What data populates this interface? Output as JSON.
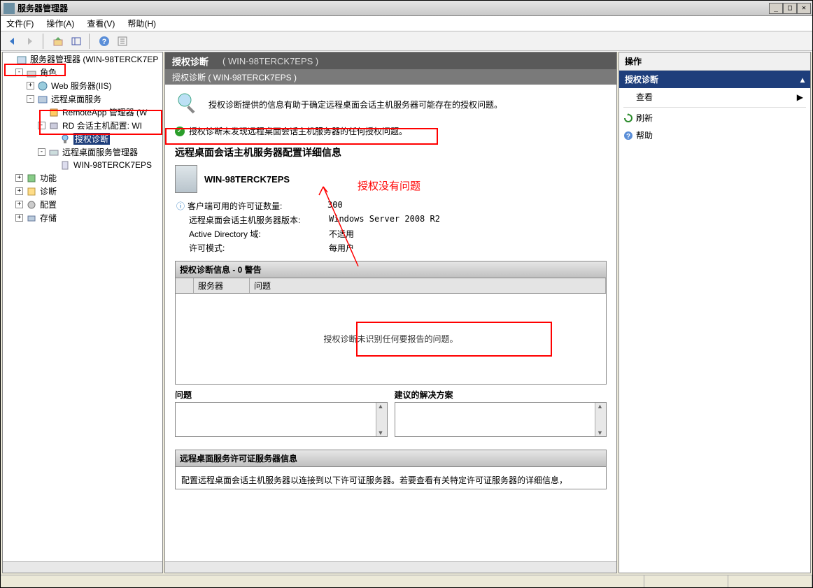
{
  "title": "服务器管理器",
  "menu": {
    "file": "文件(F)",
    "action": "操作(A)",
    "view": "查看(V)",
    "help": "帮助(H)"
  },
  "tree": {
    "root": "服务器管理器 (WIN-98TERCK7EP",
    "roles": "角色",
    "iis": "Web 服务器(IIS)",
    "rds": "远程桌面服务",
    "remoteapp": "RemoteApp 管理器  (W",
    "rdhost": "RD 会话主机配置: WI",
    "licdiag": "授权诊断",
    "rdsmgr": "远程桌面服务管理器",
    "servername": "WIN-98TERCK7EPS",
    "features": "功能",
    "diag": "诊断",
    "config": "配置",
    "storage": "存储"
  },
  "headerTitle": "授权诊断",
  "headerSub": "( WIN-98TERCK7EPS )",
  "header2": "授权诊断 ( WIN-98TERCK7EPS )",
  "intro": "授权诊断提供的信息有助于确定远程桌面会话主机服务器可能存在的授权问题。",
  "statusOk": "授权诊断未发现远程桌面会话主机服务器的任何授权问题。",
  "detailsTitle": "远程桌面会话主机服务器配置详细信息",
  "server": "WIN-98TERCK7EPS",
  "kv": {
    "licCountLabel": "客户端可用的许可证数量:",
    "licCount": "300",
    "verLabel": "远程桌面会话主机服务器版本:",
    "ver": "Windows Server 2008 R2",
    "adLabel": "Active Directory 域:",
    "ad": "不适用",
    "modeLabel": "许可模式:",
    "mode": "每用户"
  },
  "annotation": "授权没有问题",
  "diagPanel": "授权诊断信息 - 0 警告",
  "col1": "服务器",
  "col2": "问题",
  "emptyMsg": "授权诊断未识别任何要报告的问题。",
  "issue": "问题",
  "solution": "建议的解决方案",
  "licSrvPanel": "远程桌面服务许可证服务器信息",
  "licSrvText": "配置远程桌面会话主机服务器以连接到以下许可证服务器。若要查看有关特定许可证服务器的详细信息，",
  "actions": {
    "title": "操作",
    "node": "授权诊断",
    "view": "查看",
    "refresh": "刷新",
    "help": "帮助"
  }
}
